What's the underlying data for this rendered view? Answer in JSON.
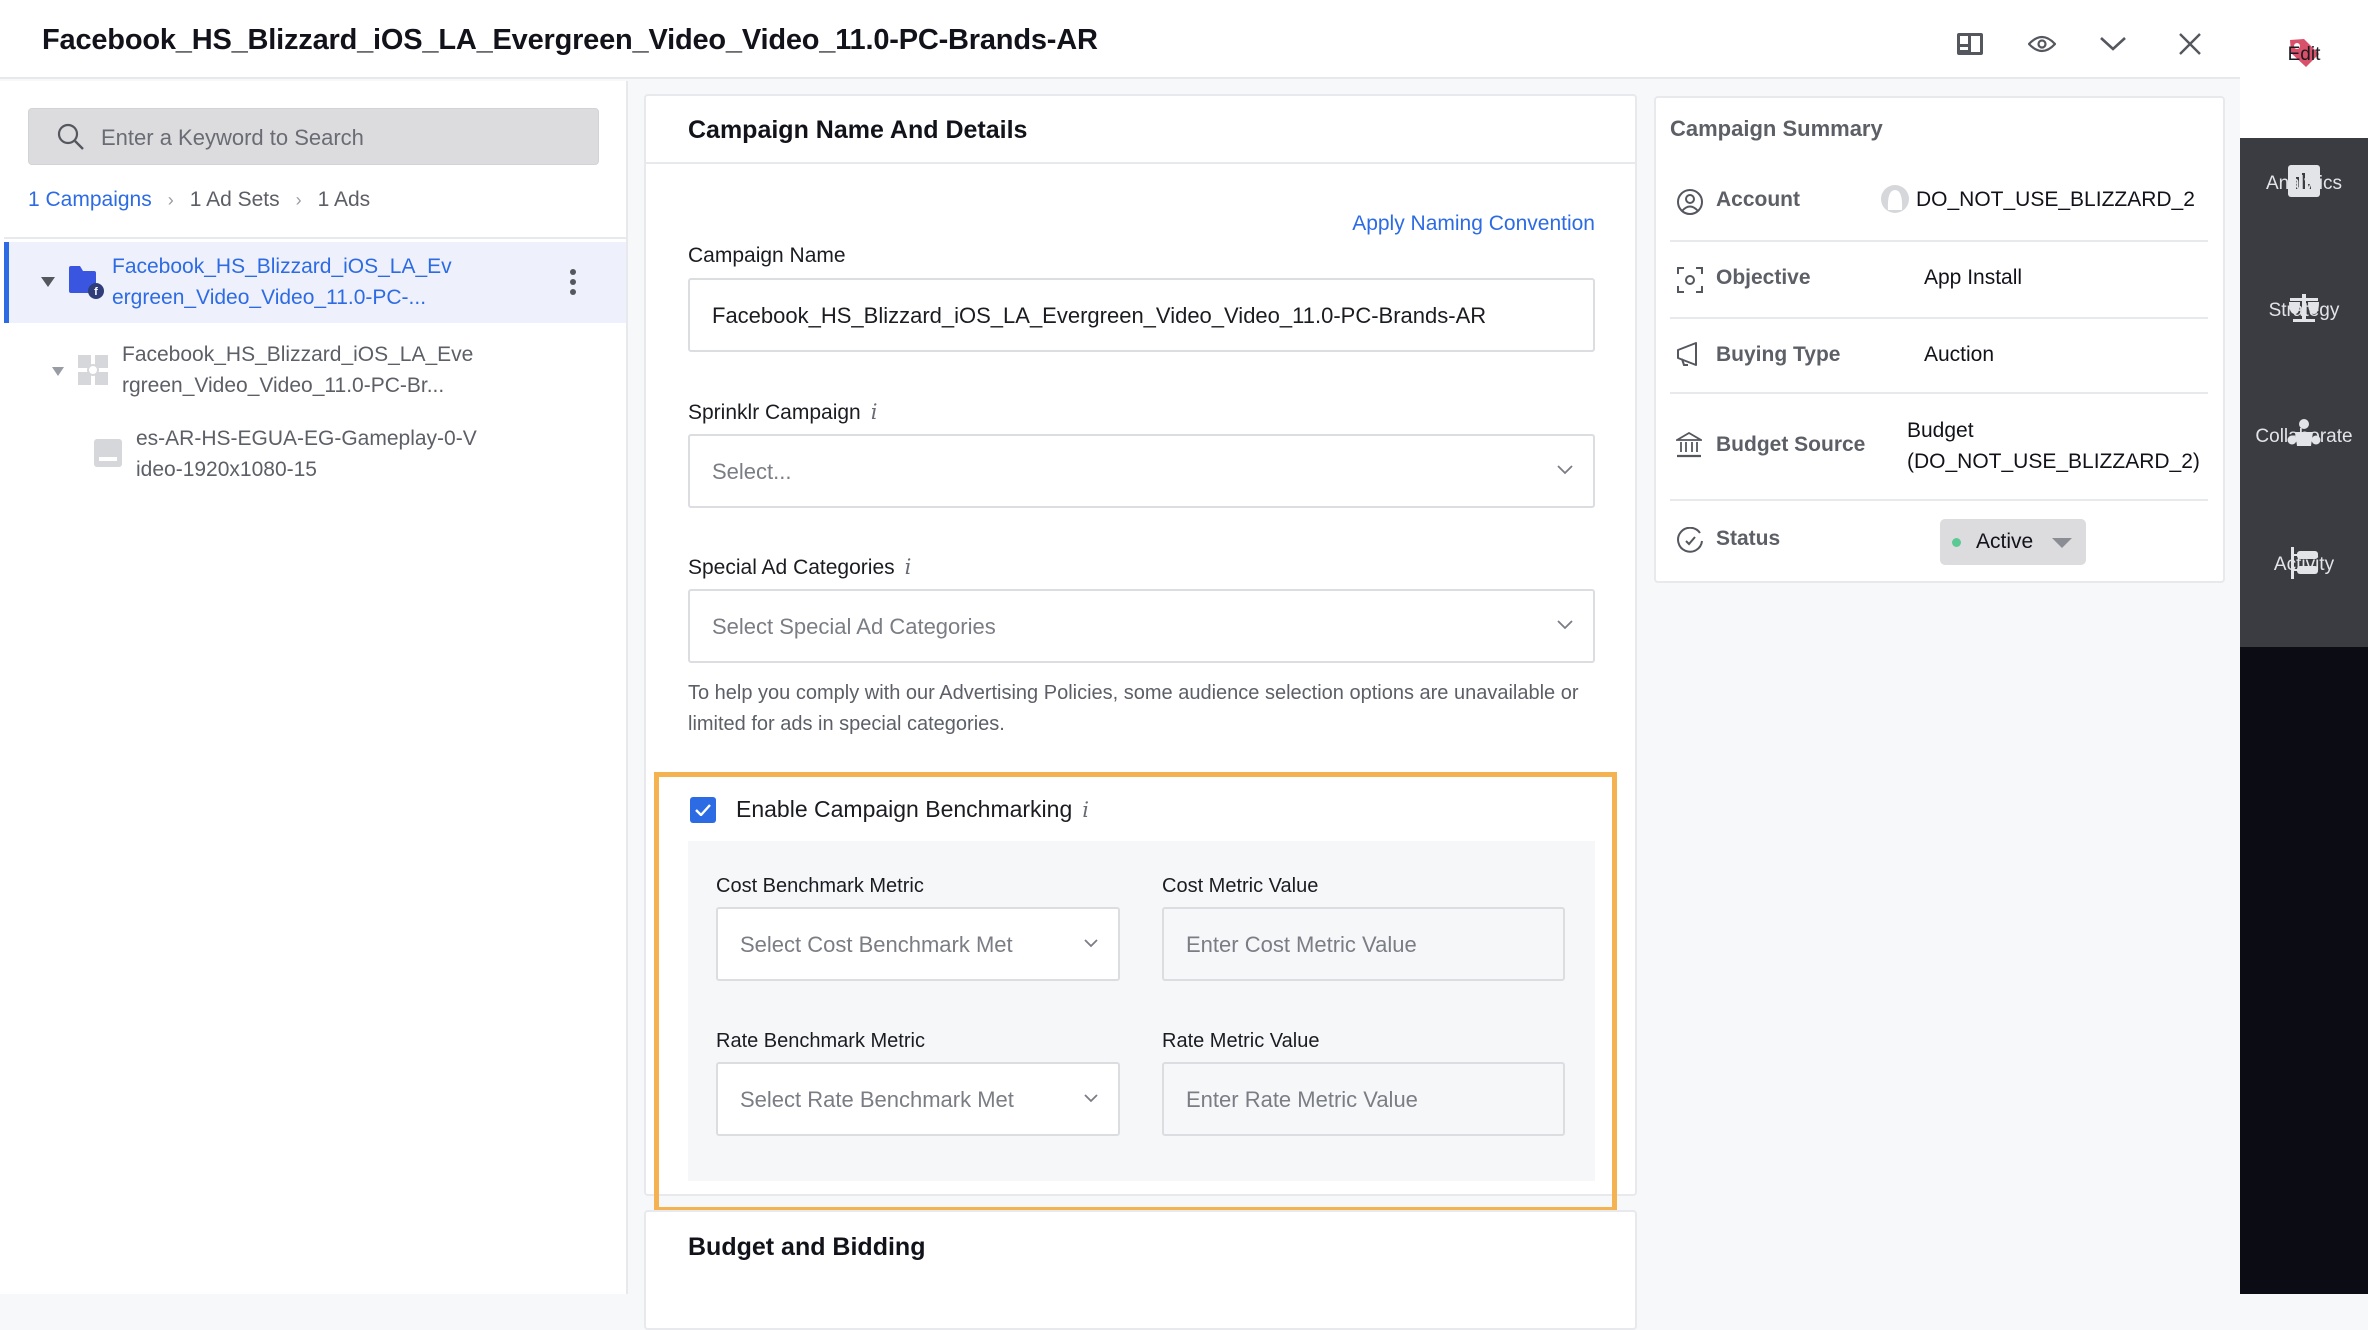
{
  "header": {
    "title": "Facebook_HS_Blizzard_iOS_LA_Evergreen_Video_Video_11.0-PC-Brands-AR",
    "icons": [
      "layout-icon",
      "eye-icon",
      "chevron-down-icon",
      "close-icon"
    ]
  },
  "rail": {
    "items": [
      {
        "label": "Edit",
        "icon": "tag-icon",
        "active": true
      },
      {
        "label": "Analytics",
        "icon": "bar-chart-icon"
      },
      {
        "label": "Strategy",
        "icon": "scale-icon"
      },
      {
        "label": "Collaborate",
        "icon": "people-icon"
      },
      {
        "label": "Activity",
        "icon": "activity-tree-icon"
      }
    ]
  },
  "left": {
    "search_placeholder": "Enter a Keyword to Search",
    "breadcrumb": {
      "campaigns": "1 Campaigns",
      "ad_sets": "1 Ad Sets",
      "ads": "1 Ads"
    },
    "tree": [
      {
        "line1": "Facebook_HS_Blizzard_iOS_LA_Ev",
        "line2": "ergreen_Video_Video_11.0-PC-...",
        "type": "campaign",
        "selected": true
      },
      {
        "line1": "Facebook_HS_Blizzard_iOS_LA_Eve",
        "line2": "rgreen_Video_Video_11.0-PC-Br...",
        "type": "ad-set"
      },
      {
        "line1": "es-AR-HS-EGUA-EG-Gameplay-0-V",
        "line2": "ideo-1920x1080-15",
        "type": "ad"
      }
    ]
  },
  "main": {
    "section_title": "Campaign Name And Details",
    "apply_naming": "Apply Naming Convention",
    "campaign_name_label": "Campaign Name",
    "campaign_name_value": "Facebook_HS_Blizzard_iOS_LA_Evergreen_Video_Video_11.0-PC-Brands-AR",
    "sprinklr_label": "Sprinklr Campaign",
    "sprinklr_placeholder": "Select...",
    "special_label": "Special Ad Categories",
    "special_placeholder": "Select Special Ad Categories",
    "help_text": "To help you comply with our Advertising Policies, some audience selection options are unavailable or limited for ads in special categories.",
    "info_glyph": "i",
    "benchmark": {
      "enabled": true,
      "label": "Enable Campaign Benchmarking",
      "cost_metric_label": "Cost Benchmark Metric",
      "cost_metric_placeholder": "Select Cost Benchmark Met",
      "cost_value_label": "Cost Metric Value",
      "cost_value_placeholder": "Enter Cost Metric Value",
      "rate_metric_label": "Rate Benchmark Metric",
      "rate_metric_placeholder": "Select Rate Benchmark Met",
      "rate_value_label": "Rate Metric Value",
      "rate_value_placeholder": "Enter Rate Metric Value"
    },
    "next_section_title": "Budget and Bidding"
  },
  "summary": {
    "title": "Campaign Summary",
    "rows": [
      {
        "key": "Account",
        "value": "DO_NOT_USE_BLIZZARD_2"
      },
      {
        "key": "Objective",
        "value": "App Install"
      },
      {
        "key": "Buying Type",
        "value": "Auction"
      },
      {
        "key": "Budget Source",
        "value_line1": "Budget",
        "value_line2": "(DO_NOT_USE_BLIZZARD_2)"
      },
      {
        "key": "Status",
        "value": "Active",
        "status_color": "#5cc995"
      }
    ]
  },
  "colors": {
    "accent": "#2d6be4",
    "highlight": "#f4b350",
    "edit_tag": "#d9506b"
  }
}
